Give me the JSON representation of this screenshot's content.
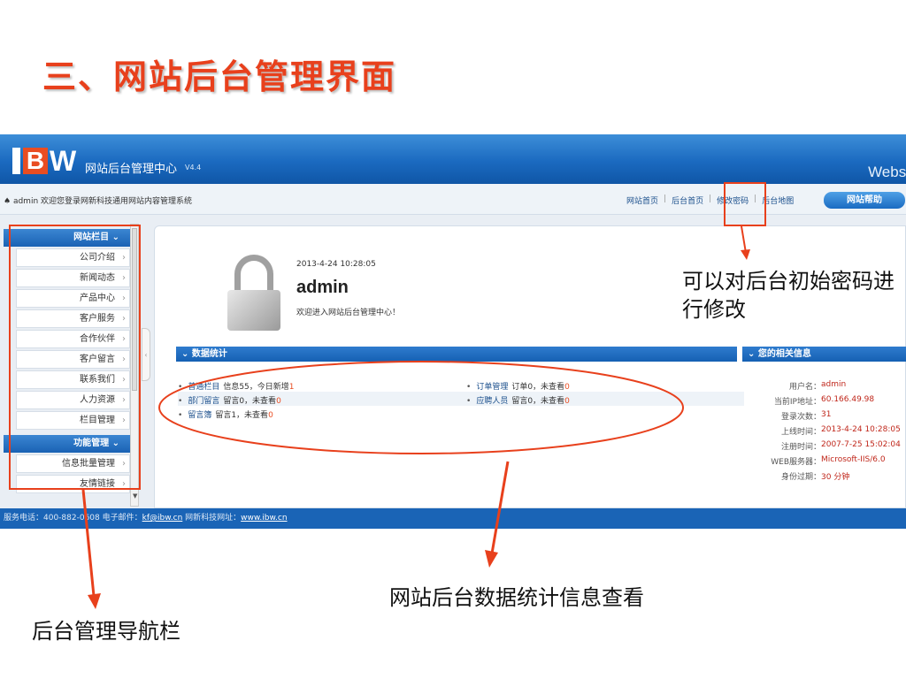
{
  "slide": {
    "title": "三、网站后台管理界面"
  },
  "banner": {
    "logo_letters": [
      "B",
      "W"
    ],
    "title": "网站后台管理中心",
    "version": "V4.4",
    "right_text": "Websi"
  },
  "topbar": {
    "welcome": "admin 欢迎您登录网新科技通用网站内容管理系统",
    "links": [
      "网站首页",
      "后台首页",
      "修改密码",
      "后台地图"
    ],
    "help_button": "网站帮助"
  },
  "sidebar": {
    "section1": "网站栏目",
    "items1": [
      "公司介绍",
      "新闻动态",
      "产品中心",
      "客户服务",
      "合作伙伴",
      "客户留言",
      "联系我们",
      "人力资源",
      "栏目管理"
    ],
    "section2": "功能管理",
    "items2": [
      "信息批量管理",
      "友情链接"
    ]
  },
  "profile": {
    "login_time": "2013-4-24 10:28:05",
    "user": "admin",
    "welcome": "欢迎进入网站后台管理中心！"
  },
  "stats": {
    "header": "数据统计",
    "rows": [
      [
        {
          "link": "普通栏目",
          "text": "信息55，今日新增",
          "hl": "1"
        },
        {
          "link": "订单管理",
          "text": "订单0，未查看",
          "hl": "0"
        }
      ],
      [
        {
          "link": "部门留言",
          "text": "留言0，未查看",
          "hl": "0"
        },
        {
          "link": "应聘人员",
          "text": "留言0，未查看",
          "hl": "0"
        }
      ],
      [
        {
          "link": "留言簿",
          "text": "留言1，未查看",
          "hl": "0"
        }
      ]
    ]
  },
  "info": {
    "header": "您的相关信息",
    "rows": [
      {
        "k": "用户名：",
        "v": "admin"
      },
      {
        "k": "当前IP地址：",
        "v": "60.166.49.98"
      },
      {
        "k": "登录次数：",
        "v": "31"
      },
      {
        "k": "上线时间：",
        "v": "2013-4-24 10:28:05"
      },
      {
        "k": "注册时间：",
        "v": "2007-7-25 15:02:04"
      },
      {
        "k": "WEB服务器：",
        "v": "Microsoft-IIS/6.0"
      },
      {
        "k": "身份过期：",
        "v": "30 分钟"
      }
    ]
  },
  "footer": {
    "prefix": "服务电话：400-882-0608 电子邮件：",
    "email": "kf@ibw.cn",
    "middle": " 网新科技网址：",
    "site": "www.ibw.cn"
  },
  "annotations": {
    "password": "可以对后台初始密码进行修改",
    "stats": "网站后台数据统计信息查看",
    "nav": "后台管理导航栏"
  },
  "colors": {
    "accent": "#e8401c",
    "banner": "#1b6ac0",
    "link": "#1b4f8c"
  }
}
